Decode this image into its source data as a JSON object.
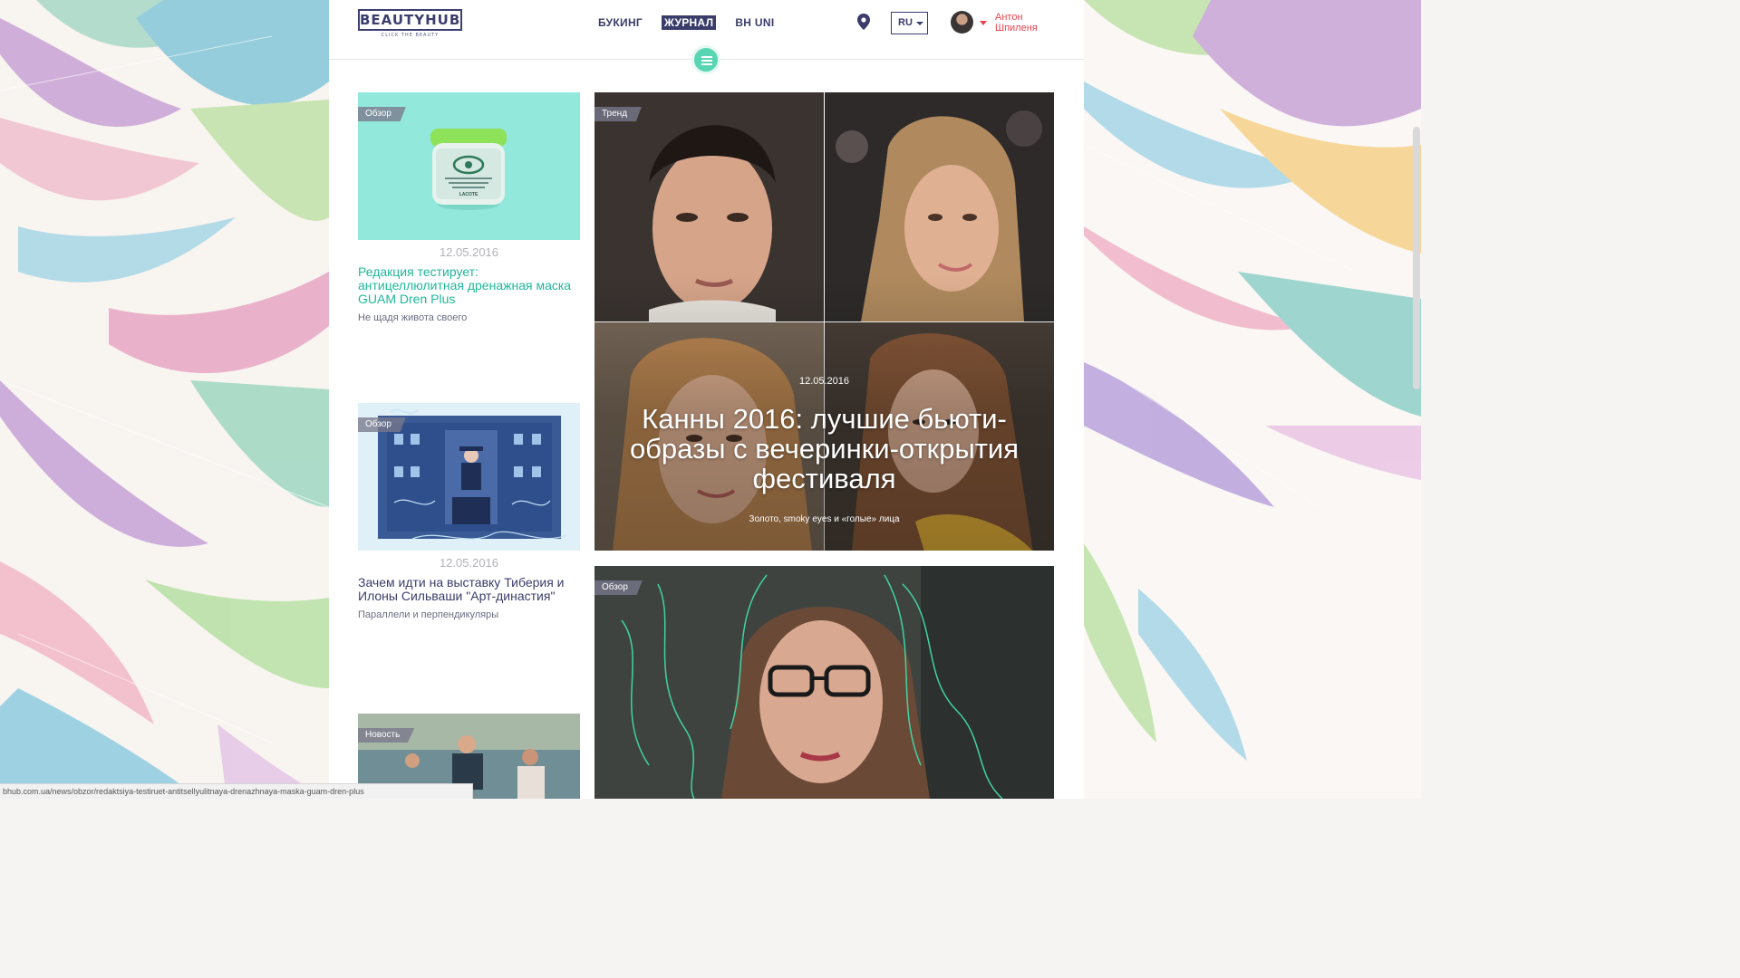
{
  "header": {
    "logo": "BEAUTYHUB",
    "tagline": "CLICK THE BEAUTY",
    "nav": [
      "БУКИНГ",
      "ЖУРНАЛ",
      "BH UNI"
    ],
    "active_nav": "ЖУРНАЛ",
    "language": "RU",
    "user_first_name": "Антон",
    "user_last_name": "Шпиленя"
  },
  "cards": [
    {
      "badge": "Обзор",
      "date": "12.05.2016",
      "title": "Редакция тестирует: антицеллюлитная дренажная маска GUAM Dren Plus",
      "subtitle": "Не щадя живота своего",
      "product_label": "LACOTE"
    },
    {
      "badge": "Обзор",
      "date": "12.05.2016",
      "title": "Зачем идти на выставку Тиберия и Илоны Сильваши \"Арт-династия\"",
      "subtitle": "Параллели и перпендикуляры"
    },
    {
      "badge": "Новость"
    }
  ],
  "feature": {
    "badge": "Тренд",
    "date": "12.05.2016",
    "title": "Канны 2016: лучшие бьюти-образы с вечеринки-открытия фестиваля",
    "subtitle": "Золото, smoky eyes и «голые» лица"
  },
  "feature2": {
    "badge": "Обзор"
  },
  "status_url": "bhub.com.ua/news/obzor/redaktsiya-testiruet-antitsellyulitnaya-drenazhnaya-maska-guam-dren-plus",
  "colors": {
    "brand_navy": "#3a3d6a",
    "accent_teal": "#1fb79a",
    "menu_button": "#58d6b4",
    "user_red": "#e8434d",
    "card1_bg": "#93e8dc"
  }
}
